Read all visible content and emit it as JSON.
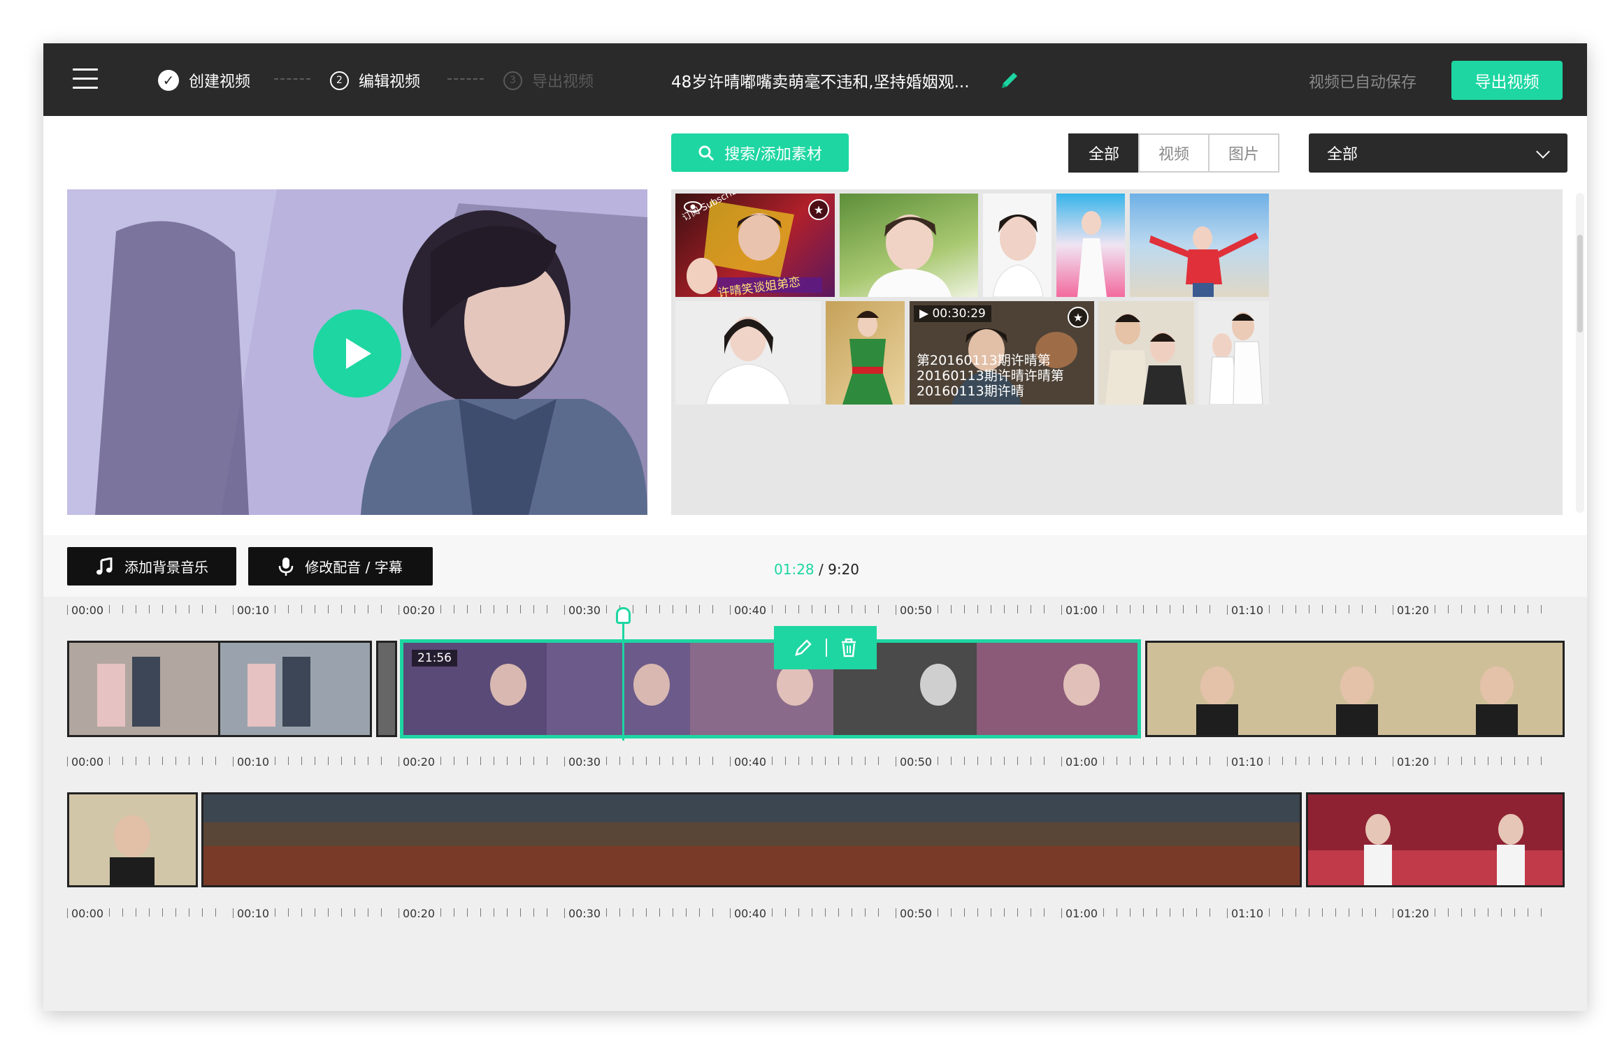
{
  "colors": {
    "accent": "#1ed6a2",
    "topbar": "#2a2a2a",
    "workspace": "#efefef"
  },
  "header": {
    "menu_icon": "hamburger-menu-icon",
    "steps": [
      {
        "label": "创建视频",
        "num": "✓",
        "state": "done"
      },
      {
        "label": "编辑视频",
        "num": "2",
        "state": "current"
      },
      {
        "label": "导出视频",
        "num": "3",
        "state": "upcoming"
      }
    ],
    "project_title": "48岁许晴嘟嘴卖萌毫不违和,坚持婚姻观...",
    "edit_icon": "pencil-icon",
    "autosave_text": "视频已自动保存",
    "export_label": "导出视频"
  },
  "media": {
    "search_label": "搜索/添加素材",
    "search_icon": "search-icon",
    "filter_tabs": [
      "全部",
      "视频",
      "图片"
    ],
    "active_filter": "全部",
    "type_select_value": "全部",
    "clip_duration": "00:30:29",
    "clip_caption": "第20160113期许晴第20160113期许晴许晴第20160113期许晴",
    "sticker_text": "许晴笑谈姐弟恋",
    "corner_text": "订阅 Subscribe"
  },
  "preview": {
    "play_icon": "play-icon"
  },
  "toolbar": {
    "music_label": "添加背景音乐",
    "music_icon": "music-note-icon",
    "voice_label": "修改配音 / 字幕",
    "voice_icon": "microphone-icon",
    "time_current": "01:28",
    "time_separator": "/",
    "time_total": "9:20"
  },
  "timeline": {
    "ruler_labels": [
      "00:00",
      "00:10",
      "00:20",
      "00:30",
      "00:40",
      "00:50",
      "01:00",
      "01:10",
      "01:20"
    ],
    "selected_clip_time": "21:56",
    "edit_tool_icon": "pencil-icon",
    "delete_tool_icon": "trash-icon"
  }
}
